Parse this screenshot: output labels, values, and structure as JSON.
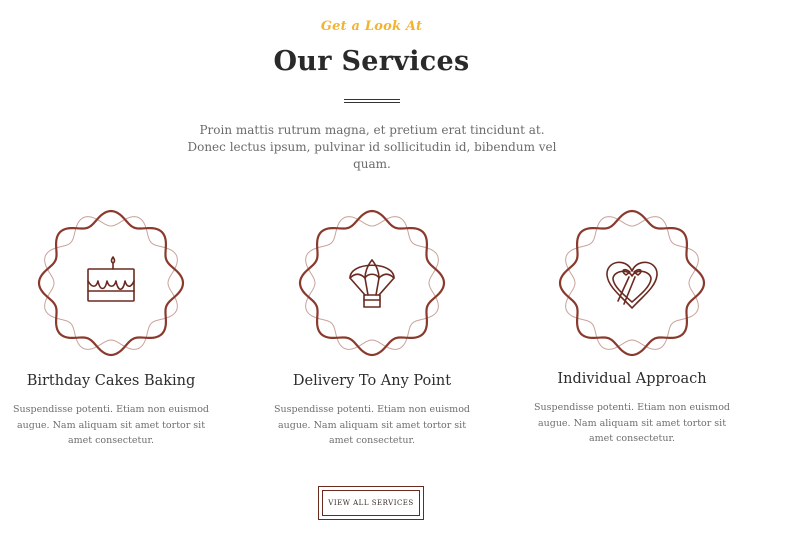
{
  "header": {
    "eyebrow": "Get a Look At",
    "title": "Our Services",
    "intro": "Proin mattis rutrum magna, et pretium erat tincidunt at. Donec lectus ipsum, pulvinar id sollicitudin id, bibendum vel quam."
  },
  "services": [
    {
      "icon": "cake-icon",
      "title": "Birthday Cakes Baking",
      "description": "Suspendisse potenti. Etiam non euismod augue. Nam aliquam sit amet tortor sit amet consectetur."
    },
    {
      "icon": "parachute-delivery-icon",
      "title": "Delivery To Any Point",
      "description": "Suspendisse potenti. Etiam non euismod augue. Nam aliquam sit amet tortor sit amet consectetur."
    },
    {
      "icon": "heart-gift-box-icon",
      "title": "Individual Approach",
      "description": "Suspendisse potenti. Etiam non euismod augue. Nam aliquam sit amet tortor sit amet consectetur."
    }
  ],
  "cta": {
    "label": "VIEW ALL SERVICES"
  },
  "colors": {
    "accent": "#f2b330",
    "badge_main": "#8a3a2c",
    "badge_light": "#c9a29a",
    "title": "#2a2a2a",
    "text": "#6b6b6b"
  }
}
